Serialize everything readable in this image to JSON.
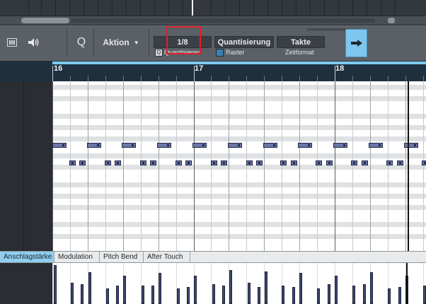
{
  "toolbar": {
    "info_icon": "keyboard-icon",
    "speaker_icon": "speaker-icon",
    "quantize_key": "Q",
    "action_label": "Aktion",
    "quantize_value": "1/8",
    "quantize_mode": "Quantisierung",
    "time_format_value": "Takte",
    "quantize_checkbox_glyph": "Q",
    "quantize_caption": "Quantisieren",
    "grid_caption": "Raster",
    "time_format_caption": "Zeitformat",
    "arrow_icon": "arrow-right-icon"
  },
  "ruler": {
    "bars": [
      "16",
      "17",
      "18"
    ]
  },
  "lane_tabs": [
    "Anschlagstärke",
    "Modulation",
    "Pitch Bend",
    "After Touch"
  ],
  "colors": {
    "accent": "#7cc8f0",
    "note_fill": "#6c76a8",
    "highlight": "#e0202a"
  }
}
